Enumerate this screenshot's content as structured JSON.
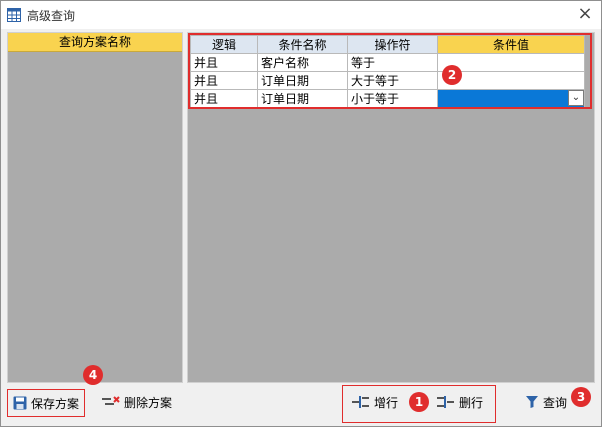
{
  "window": {
    "title": "高级查询",
    "icons": {
      "app": "table-icon",
      "close": "close-icon"
    }
  },
  "left_panel": {
    "header": "查询方案名称"
  },
  "grid": {
    "columns": [
      "逻辑",
      "条件名称",
      "操作符",
      "条件值"
    ],
    "rows": [
      [
        "并且",
        "客户名称",
        "等于",
        ""
      ],
      [
        "并且",
        "订单日期",
        "大于等于",
        ""
      ],
      [
        "并且",
        "订单日期",
        "小于等于",
        ""
      ]
    ]
  },
  "toolbar": {
    "save_label": "保存方案",
    "delete_scheme_label": "删除方案",
    "add_row_label": "增行",
    "delete_row_label": "删行",
    "query_label": "查询"
  },
  "badges": {
    "b1": "1",
    "b2": "2",
    "b3": "3",
    "b4": "4"
  },
  "colors": {
    "highlight": "#f9d34f",
    "selection": "#0a78d7",
    "annotation": "#e02d2d"
  }
}
